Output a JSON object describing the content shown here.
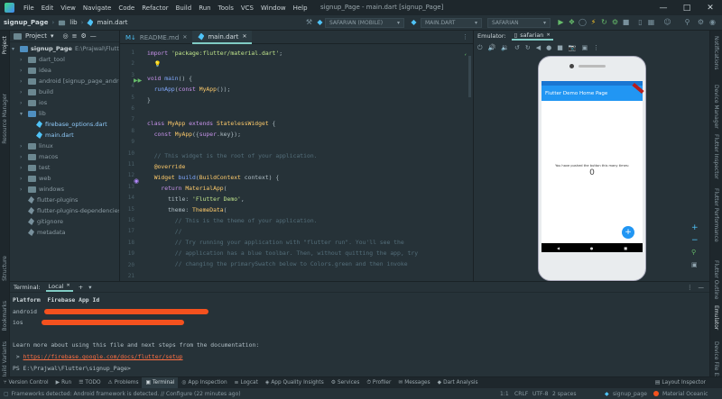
{
  "titlebar": {
    "menu": [
      "File",
      "Edit",
      "View",
      "Navigate",
      "Code",
      "Refactor",
      "Build",
      "Run",
      "Tools",
      "VCS",
      "Window",
      "Help"
    ],
    "window_title": "signup_Page - main.dart [signup_Page]"
  },
  "navbar": {
    "crumbs": [
      "signup_Page",
      "lib",
      "main.dart"
    ],
    "device_combo": "SAFARIAN (MOBILE)",
    "config_combo": "MAIN.DART",
    "emulator_combo": "SAFARIAN"
  },
  "project": {
    "header": "Project",
    "root": "signup_Page",
    "root_path": "E:\\Prajwal\\Flutter\\signup_Page",
    "items": [
      {
        "label": "dart_tool",
        "depth": 1,
        "kind": "folder"
      },
      {
        "label": "idea",
        "depth": 1,
        "kind": "folder"
      },
      {
        "label": "android [signup_page_android]",
        "depth": 1,
        "kind": "folder"
      },
      {
        "label": "build",
        "depth": 1,
        "kind": "folder"
      },
      {
        "label": "ios",
        "depth": 1,
        "kind": "folder"
      },
      {
        "label": "lib",
        "depth": 1,
        "kind": "folder-open"
      },
      {
        "label": "firebase_options.dart",
        "depth": 2,
        "kind": "dart"
      },
      {
        "label": "main.dart",
        "depth": 2,
        "kind": "dart"
      },
      {
        "label": "linux",
        "depth": 1,
        "kind": "folder"
      },
      {
        "label": "macos",
        "depth": 1,
        "kind": "folder"
      },
      {
        "label": "test",
        "depth": 1,
        "kind": "folder"
      },
      {
        "label": "web",
        "depth": 1,
        "kind": "folder"
      },
      {
        "label": "windows",
        "depth": 1,
        "kind": "folder"
      },
      {
        "label": "flutter-plugins",
        "depth": 1,
        "kind": "file"
      },
      {
        "label": "flutter-plugins-dependencies",
        "depth": 1,
        "kind": "file"
      },
      {
        "label": "gitignore",
        "depth": 1,
        "kind": "file"
      },
      {
        "label": "metadata",
        "depth": 1,
        "kind": "file"
      }
    ]
  },
  "editor": {
    "tabs": [
      "README.md",
      "main.dart"
    ],
    "line_numbers": [
      "1",
      "2",
      "3",
      "4",
      "5",
      "6",
      "7",
      "8",
      "9",
      "10",
      "11",
      "12",
      "13",
      "14",
      "15",
      "16",
      "17",
      "18",
      "19",
      "20",
      "21"
    ]
  },
  "emulator": {
    "tab_label": "Emulator:",
    "device": "safarian",
    "app_title": "Flutter Demo Home Page",
    "counter_text": "You have pushed the button this many times:",
    "counter_value": "0",
    "fab_label": "+"
  },
  "terminal": {
    "title": "Terminal:",
    "tab": "Local",
    "header_platform": "Platform",
    "header_app_id": "Firebase App Id",
    "row1": "android",
    "row2": "ios",
    "learn_more": "Learn more about using this file and next steps from the documentation:",
    "link_prefix": " > ",
    "link": "https://firebase.google.com/docs/flutter/setup",
    "prompt": "PS E:\\Prajwal\\Flutter\\signup_Page>"
  },
  "toolwindows": [
    "Version Control",
    "Run",
    "TODO",
    "Problems",
    "Terminal",
    "App Inspection",
    "Logcat",
    "App Quality Insights",
    "Services",
    "Profiler",
    "Messages",
    "Dart Analysis",
    "Layout Inspector"
  ],
  "status": {
    "message": "Frameworks detected: Android framework is detected. // Configure (22 minutes ago)",
    "position": "1:1",
    "line_sep": "CRLF",
    "encoding": "UTF-8",
    "indent": "2 spaces",
    "project": "signup_page",
    "theme": "Material Oceanic"
  },
  "colors": {
    "accent": "#80cbc4",
    "redaction": "#f4511e",
    "flutter_blue": "#2196f3"
  }
}
